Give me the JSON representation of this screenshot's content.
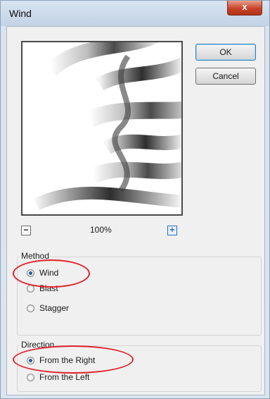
{
  "window": {
    "title": "Wind",
    "close_glyph": "x"
  },
  "buttons": {
    "ok": "OK",
    "cancel": "Cancel"
  },
  "zoom": {
    "level": "100%",
    "minus": "−",
    "plus": "+"
  },
  "method": {
    "label": "Method",
    "options": [
      {
        "label": "Wind",
        "checked": true
      },
      {
        "label": "Blast",
        "checked": false
      },
      {
        "label": "Stagger",
        "checked": false
      }
    ]
  },
  "direction": {
    "label": "Direction",
    "options": [
      {
        "label": "From the Right",
        "checked": true
      },
      {
        "label": "From the Left",
        "checked": false
      }
    ]
  },
  "annotation_color": "#e0202a"
}
